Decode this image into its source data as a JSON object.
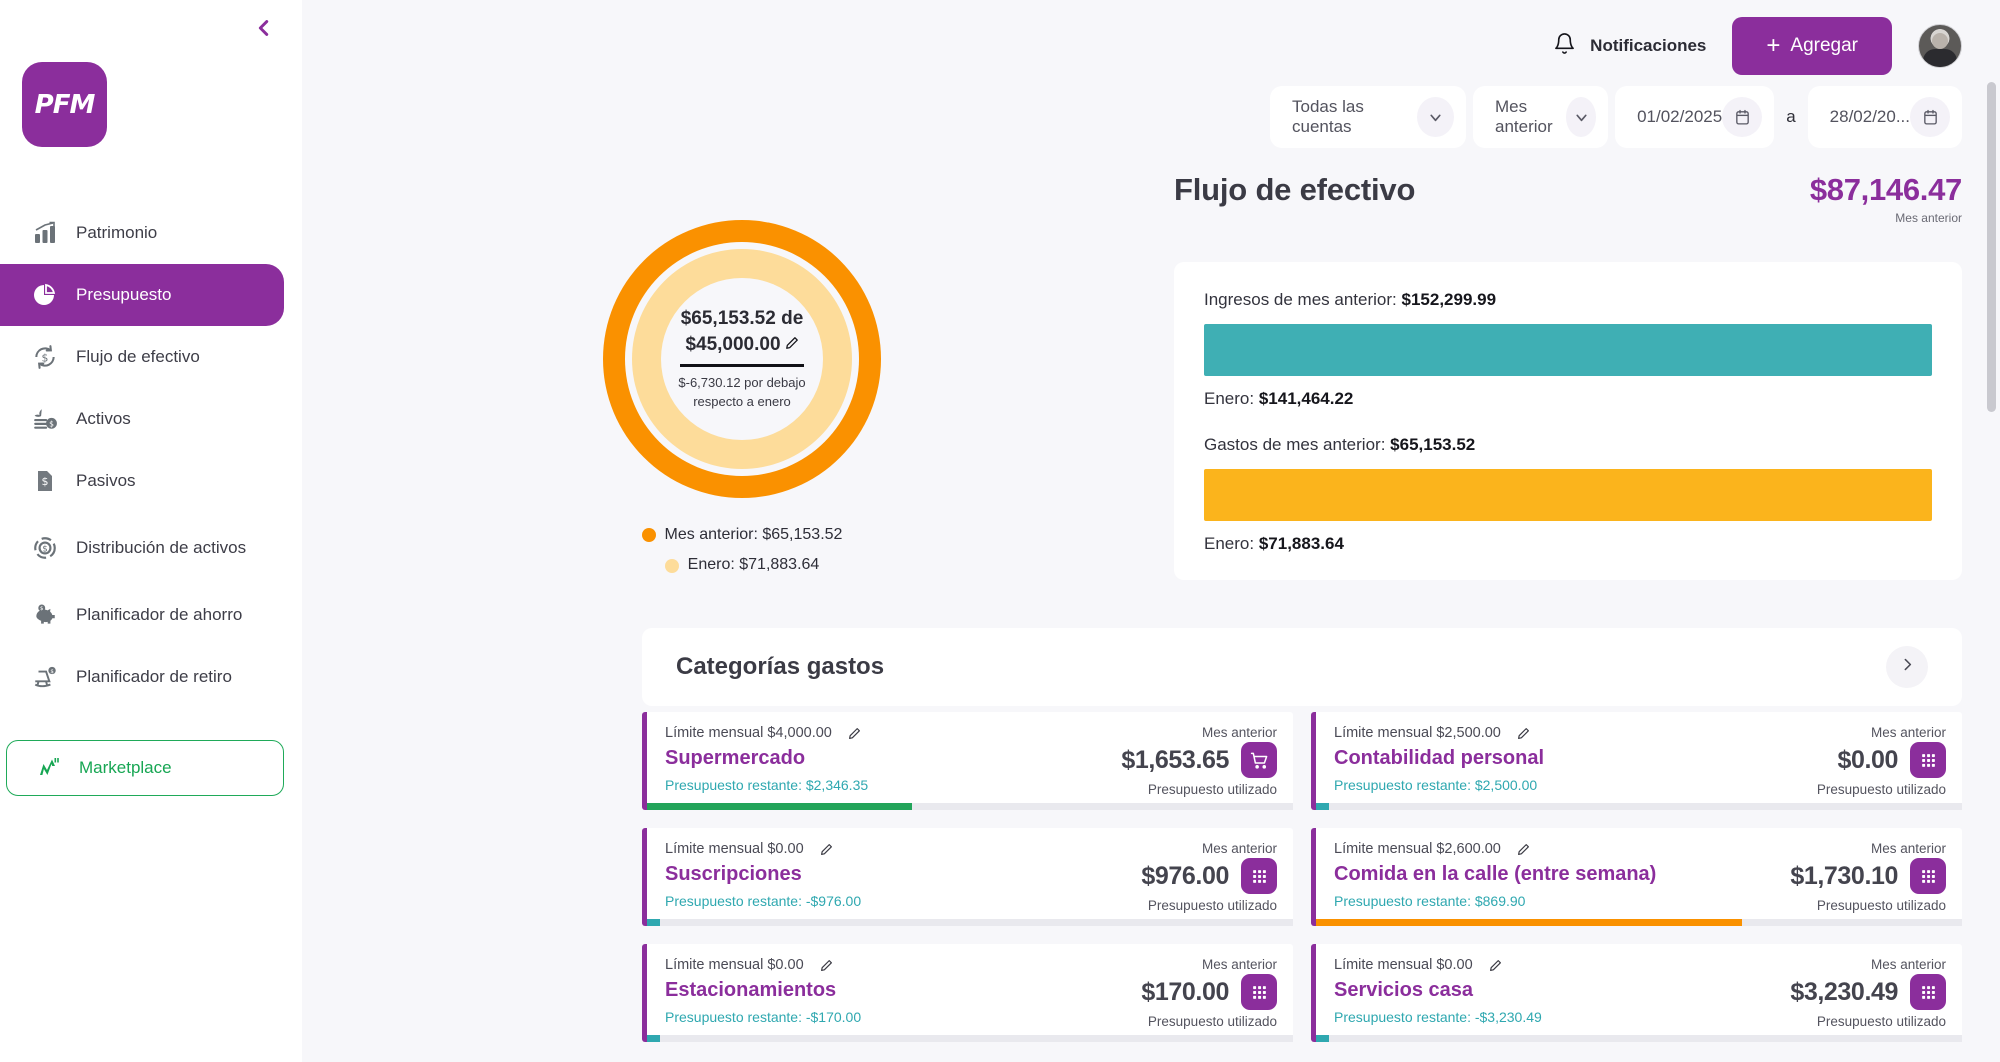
{
  "sidebar": {
    "logo_text": "PFM",
    "collapse_icon": "chevron-left-icon",
    "items": [
      {
        "label": "Patrimonio",
        "icon": "bar-chart-icon",
        "active": false
      },
      {
        "label": "Presupuesto",
        "icon": "pie-chart-icon",
        "active": true
      },
      {
        "label": "Flujo de efectivo",
        "icon": "cash-flow-icon",
        "active": false
      },
      {
        "label": "Activos",
        "icon": "assets-icon",
        "active": false
      },
      {
        "label": "Pasivos",
        "icon": "liabilities-icon",
        "active": false
      },
      {
        "label": "Distribución de activos",
        "icon": "asset-distribution-icon",
        "active": false
      },
      {
        "label": "Planificador de ahorro",
        "icon": "piggy-bank-icon",
        "active": false
      },
      {
        "label": "Planificador de retiro",
        "icon": "retirement-icon",
        "active": false
      }
    ],
    "marketplace": {
      "label": "Marketplace",
      "icon": "marketplace-icon",
      "color": "#17a653"
    }
  },
  "topbar": {
    "notifications_label": "Notificaciones",
    "notifications_icon": "bell-icon",
    "add_label": "Agregar",
    "add_icon": "plus-icon",
    "avatar": "user-avatar"
  },
  "filters": {
    "accounts": {
      "value": "Todas las cuentas",
      "icon": "chevron-down-icon"
    },
    "period": {
      "value": "Mes anterior",
      "icon": "chevron-down-icon"
    },
    "date_from": {
      "value": "01/02/2025",
      "icon": "calendar-icon"
    },
    "separator": "a",
    "date_to": {
      "value": "28/02/20...",
      "icon": "calendar-icon"
    }
  },
  "cashflow": {
    "title": "Flujo de efectivo",
    "total": "$87,146.47",
    "total_sub": "Mes anterior",
    "income_label": "Ingresos de mes anterior:",
    "income_value": "$152,299.99",
    "income_prev_label": "Enero:",
    "income_prev_value": "$141,464.22",
    "expense_label": "Gastos de mes anterior:",
    "expense_value": "$65,153.52",
    "expense_prev_label": "Enero:",
    "expense_prev_value": "$71,883.64"
  },
  "donut": {
    "main_line1": "$65,153.52 de",
    "main_line2": "$45,000.00",
    "edit_icon": "pencil-icon",
    "sub_line1": "$-6,730.12 por debajo",
    "sub_line2": "respecto a enero",
    "legend": [
      {
        "label": "Mes anterior: $65,153.52",
        "color": "#FA9100"
      },
      {
        "label": "Enero: $71,883.64",
        "color": "#FDDC9A"
      }
    ]
  },
  "categories_section": {
    "title": "Categorías gastos",
    "next_icon": "chevron-right-icon",
    "labels": {
      "limit_prefix": "Límite mensual",
      "remaining_prefix": "Presupuesto restante:",
      "period": "Mes anterior",
      "used": "Presupuesto utilizado"
    },
    "items": [
      {
        "limit": "Límite mensual $4,000.00",
        "name": "Supermercado",
        "remaining": "Presupuesto restante: $2,346.35",
        "period": "Mes anterior",
        "amount": "$1,653.65",
        "used": "Presupuesto utilizado",
        "icon": "shopping-cart-icon",
        "progress_pct": 41,
        "progress_color": "#22A45A"
      },
      {
        "limit": "Límite mensual $2,500.00",
        "name": "Contabilidad personal",
        "remaining": "Presupuesto restante: $2,500.00",
        "period": "Mes anterior",
        "amount": "$0.00",
        "used": "Presupuesto utilizado",
        "icon": "grid-icon",
        "progress_pct": 2,
        "progress_color": "#2FA8B0"
      },
      {
        "limit": "Límite mensual $0.00",
        "name": "Suscripciones",
        "remaining": "Presupuesto restante: -$976.00",
        "period": "Mes anterior",
        "amount": "$976.00",
        "used": "Presupuesto utilizado",
        "icon": "grid-icon",
        "progress_pct": 2,
        "progress_color": "#2FA8B0"
      },
      {
        "limit": "Límite mensual $2,600.00",
        "name": "Comida en la calle (entre semana)",
        "remaining": "Presupuesto restante: $869.90",
        "period": "Mes anterior",
        "amount": "$1,730.10",
        "used": "Presupuesto utilizado",
        "icon": "grid-icon",
        "progress_pct": 66,
        "progress_color": "#FA9100"
      },
      {
        "limit": "Límite mensual $0.00",
        "name": "Estacionamientos",
        "remaining": "Presupuesto restante: -$170.00",
        "period": "Mes anterior",
        "amount": "$170.00",
        "used": "Presupuesto utilizado",
        "icon": "grid-icon",
        "progress_pct": 2,
        "progress_color": "#2FA8B0"
      },
      {
        "limit": "Límite mensual $0.00",
        "name": "Servicios casa",
        "remaining": "Presupuesto restante: -$3,230.49",
        "period": "Mes anterior",
        "amount": "$3,230.49",
        "used": "Presupuesto utilizado",
        "icon": "grid-icon",
        "progress_pct": 2,
        "progress_color": "#2FA8B0"
      }
    ]
  },
  "chart_data": [
    {
      "type": "pie",
      "title": "Presupuesto mes anterior vs enero",
      "labels": [
        "Mes anterior",
        "Enero"
      ],
      "values": [
        65153.52,
        71883.64
      ],
      "colors": [
        "#FA9100",
        "#FDDC9A"
      ],
      "budget_limit": 45000.0,
      "center_text": "$65,153.52 de $45,000.00",
      "annotation": "$-6,730.12 por debajo respecto a enero",
      "legend_position": "bottom"
    },
    {
      "type": "bar",
      "title": "Flujo de efectivo",
      "orientation": "horizontal",
      "categories": [
        "Ingresos de mes anterior",
        "Gastos de mes anterior"
      ],
      "series": [
        {
          "name": "Mes anterior",
          "values": [
            152299.99,
            65153.52
          ],
          "colors": [
            "#3FAFB4",
            "#FBB41C"
          ]
        },
        {
          "name": "Enero",
          "values": [
            141464.22,
            71883.64
          ]
        }
      ],
      "total": 87146.47,
      "grid": false,
      "legend_position": "none"
    }
  ],
  "colors": {
    "brand_purple": "#8B2E9C",
    "orange": "#FA9100",
    "light_orange": "#FDDC9A",
    "teal": "#3FAFB4",
    "yellow": "#FBB41C",
    "green": "#22A45A",
    "background": "#f7f7fa"
  }
}
